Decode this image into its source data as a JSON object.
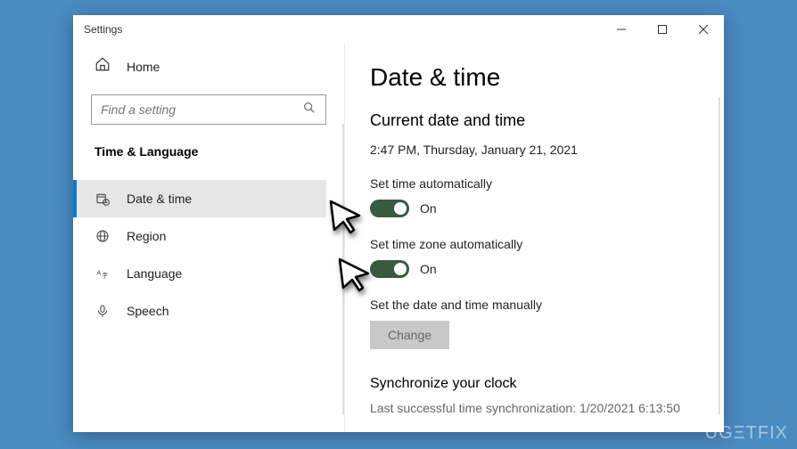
{
  "titlebar": {
    "title": "Settings"
  },
  "sidebar": {
    "home_label": "Home",
    "search_placeholder": "Find a setting",
    "section_title": "Time & Language",
    "items": [
      {
        "label": "Date & time"
      },
      {
        "label": "Region"
      },
      {
        "label": "Language"
      },
      {
        "label": "Speech"
      }
    ]
  },
  "content": {
    "page_title": "Date & time",
    "current_heading": "Current date and time",
    "current_value": "2:47 PM, Thursday, January 21, 2021",
    "set_time_auto_label": "Set time automatically",
    "set_time_auto_state": "On",
    "set_tz_auto_label": "Set time zone automatically",
    "set_tz_auto_state": "On",
    "manual_label": "Set the date and time manually",
    "change_button": "Change",
    "sync_heading": "Synchronize your clock",
    "sync_sub": "Last successful time synchronization: 1/20/2021 6:13:50"
  },
  "watermark": "UGΞTFIX"
}
